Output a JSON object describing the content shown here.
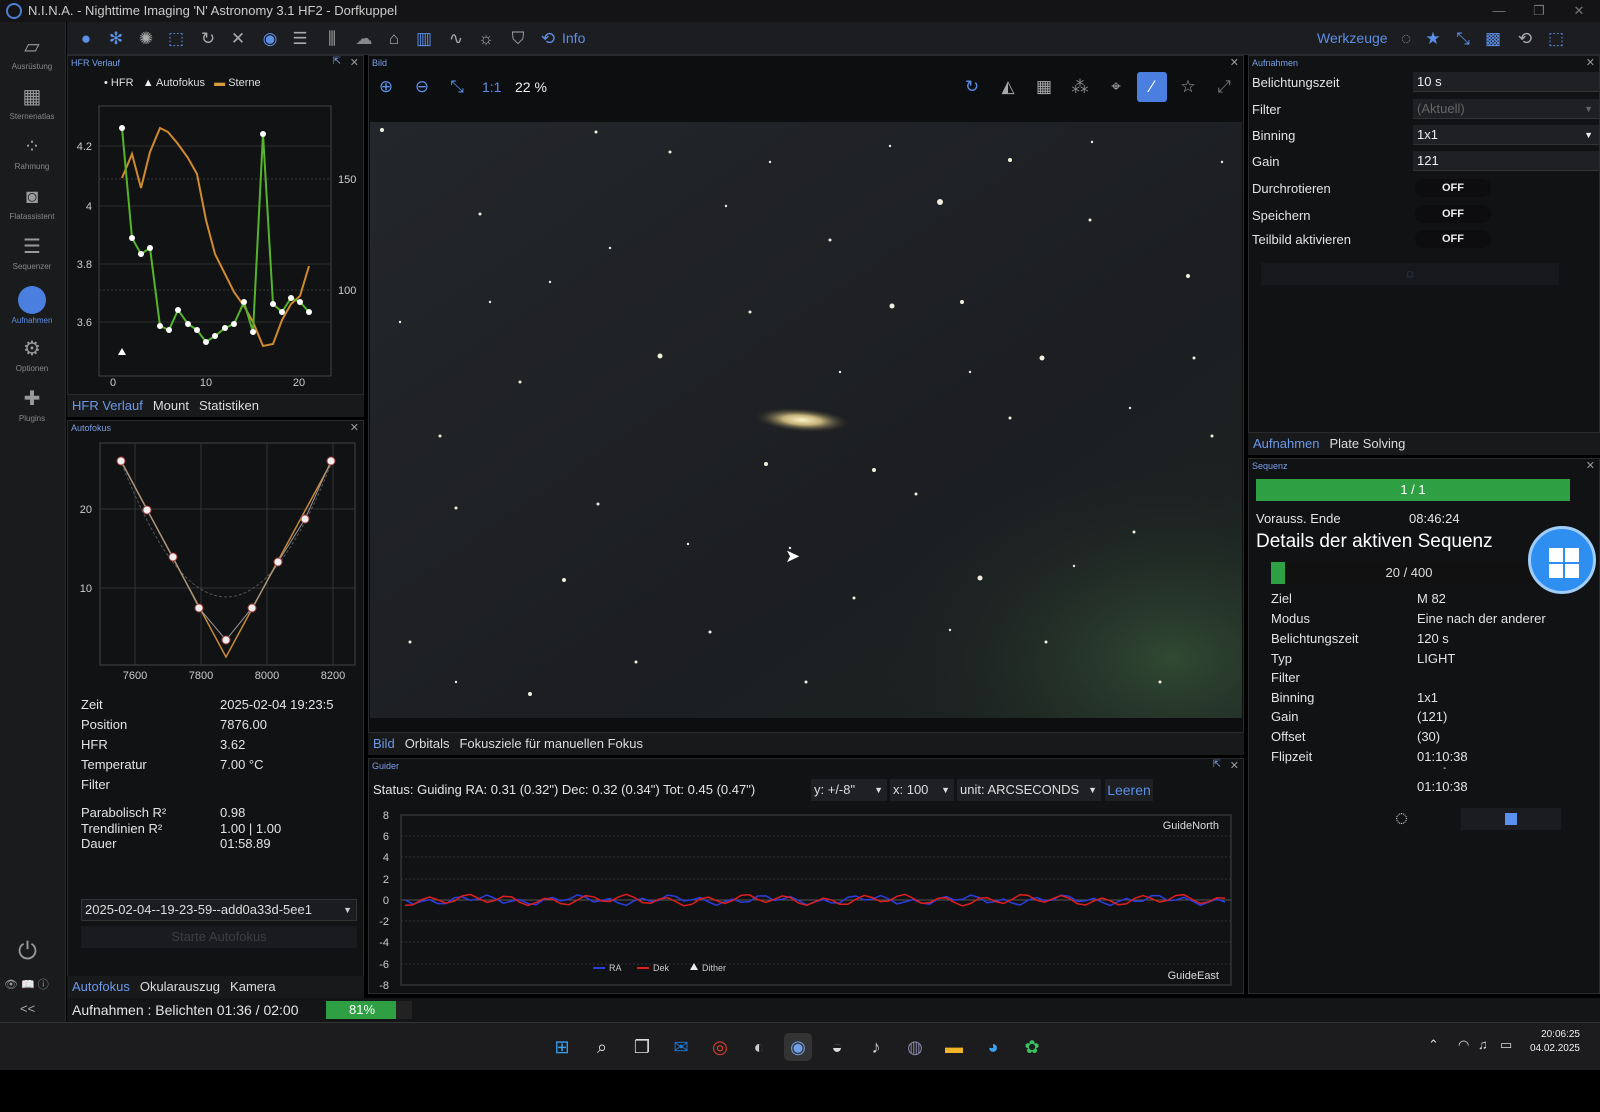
{
  "window": {
    "title": "N.I.N.A. - Nighttime Imaging 'N' Astronomy 3.1 HF2  - Dorfkuppel"
  },
  "sidebar": {
    "items": [
      {
        "label": "Ausrüstung",
        "icon": "equipment-icon"
      },
      {
        "label": "Sternenatlas",
        "icon": "star-atlas-icon"
      },
      {
        "label": "Rahmung",
        "icon": "framing-icon"
      },
      {
        "label": "Flatassistent",
        "icon": "flat-wizard-icon"
      },
      {
        "label": "Sequenzer",
        "icon": "sequencer-icon"
      },
      {
        "label": "Aufnahmen",
        "icon": "imaging-icon",
        "active": true
      },
      {
        "label": "Optionen",
        "icon": "options-icon"
      },
      {
        "label": "Plugins",
        "icon": "plugins-icon"
      }
    ],
    "collapse": "<<"
  },
  "toolbar": {
    "info_label": "Info",
    "werkzeuge_label": "Werkzeuge"
  },
  "hfr_panel": {
    "title": "HFR Verlauf",
    "legend": [
      "HFR",
      "Autofokus",
      "Sterne"
    ],
    "tabs": [
      "HFR Verlauf",
      "Mount",
      "Statistiken"
    ]
  },
  "hfr_chart": {
    "y_ticks": [
      "4.2",
      "4",
      "3.8",
      "3.6"
    ],
    "y2_ticks": [
      "150",
      "100"
    ],
    "x_ticks": [
      "0",
      "10",
      "20"
    ]
  },
  "autofocus_panel": {
    "title": "Autofokus",
    "x_ticks": [
      "7600",
      "7800",
      "8000",
      "8200"
    ],
    "y_ticks": [
      "20",
      "10"
    ],
    "info": [
      {
        "label": "Zeit",
        "value": "2025-02-04 19:23:5"
      },
      {
        "label": "Position",
        "value": "7876.00"
      },
      {
        "label": "HFR",
        "value": "3.62"
      },
      {
        "label": "Temperatur",
        "value": "7.00 °C"
      },
      {
        "label": "Filter",
        "value": ""
      }
    ],
    "fit": [
      {
        "label": "Parabolisch R²",
        "value": "0.98"
      },
      {
        "label": "Trendlinien R²",
        "value": "1.00 | 1.00"
      },
      {
        "label": "Dauer",
        "value": "01:58.89"
      }
    ],
    "dropdown": "2025-02-04--19-23-59--add0a33d-5ee1",
    "start_button": "Starte Autofokus",
    "tabs": [
      "Autofokus",
      "Okularauszug",
      "Kamera"
    ]
  },
  "image_panel": {
    "title": "Bild",
    "zoom_label": "1:1",
    "zoom_percent": "22 %",
    "tabs": [
      "Bild",
      "Orbitals",
      "Fokusziele für manuellen Fokus"
    ]
  },
  "guider": {
    "title": "Guider",
    "status": "Status: Guiding RA: 0.31 (0.32\") Dec: 0.32 (0.34\") Tot: 0.45 (0.47\")",
    "y_select": "y: +/-8\"",
    "x_select": "x: 100",
    "unit_select": "unit: ARCSECONDS",
    "clear_button": "Leeren",
    "y_ticks": [
      "8",
      "6",
      "4",
      "2",
      "0",
      "-2",
      "-4",
      "-6",
      "-8"
    ],
    "label_north": "GuideNorth",
    "label_east": "GuideEast",
    "legend": [
      "RA",
      "Dek",
      "Dither"
    ],
    "colors": {
      "ra": "#2a3ee0",
      "dec": "#e01e1e"
    }
  },
  "aufnahmen_panel": {
    "title": "Aufnahmen",
    "rows": [
      {
        "label": "Belichtungszeit",
        "value": "10 s"
      },
      {
        "label": "Filter",
        "value": "(Aktuell)"
      },
      {
        "label": "Binning",
        "value": "1x1"
      },
      {
        "label": "Gain",
        "value": "121"
      }
    ],
    "toggles": [
      {
        "label": "Durchrotieren",
        "value": "OFF"
      },
      {
        "label": "Speichern",
        "value": "OFF"
      },
      {
        "label": "Teilbild aktivieren",
        "value": "OFF"
      }
    ],
    "tabs": [
      "Aufnahmen",
      "Plate Solving"
    ]
  },
  "sequence_panel": {
    "title": "Sequenz",
    "progress": "1 / 1",
    "progress_fraction": 1.0,
    "end_label": "Vorauss. Ende",
    "end_value": "08:46:24",
    "heading": "Details der aktiven Sequenz",
    "sub_progress": "20 / 400",
    "sub_fraction": 0.05,
    "details": [
      {
        "label": "Ziel",
        "value": "M 82"
      },
      {
        "label": "Modus",
        "value": "Eine nach der anderer"
      },
      {
        "label": "Belichtungszeit",
        "value": "120 s"
      },
      {
        "label": "Typ",
        "value": "LIGHT"
      },
      {
        "label": "Filter",
        "value": ""
      },
      {
        "label": "Binning",
        "value": "1x1"
      },
      {
        "label": "Gain",
        "value": "(121)"
      },
      {
        "label": "Offset",
        "value": "(30)"
      },
      {
        "label": "Flipzeit",
        "value": "01:10:38"
      }
    ],
    "flip_dash": "-",
    "flip_second": "01:10:38"
  },
  "statusbar": {
    "text": "Aufnahmen :  Belichten 01:36 / 02:00",
    "percent": "81%",
    "fraction": 0.81
  },
  "taskbar": {
    "time": "20:06:25",
    "date": "04.02.2025"
  }
}
